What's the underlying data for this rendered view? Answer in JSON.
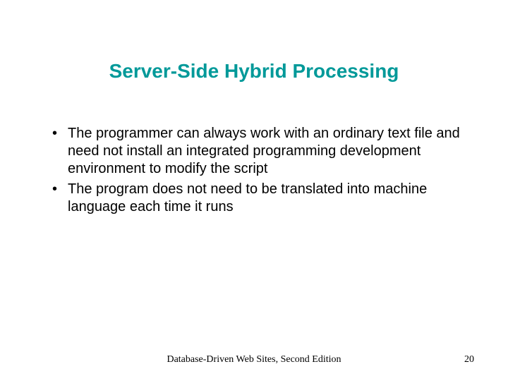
{
  "title": "Server-Side Hybrid Processing",
  "bullets": [
    "The programmer can always work with an ordinary text file and need not install an integrated programming development environment to modify the script",
    "The program does not need to be translated into machine language each time it runs"
  ],
  "footer": {
    "center": "Database-Driven Web Sites, Second Edition",
    "pageNumber": "20"
  }
}
